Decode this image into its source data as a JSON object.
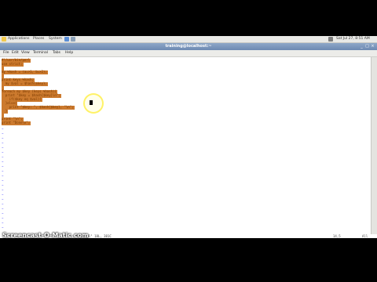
{
  "panel": {
    "items": [
      "Applications",
      "Places",
      "System"
    ],
    "clock": "Sat Jul 27, 8:51 AM"
  },
  "window": {
    "title": "training@localhost:~"
  },
  "menubar": {
    "items": [
      "File",
      "Edit",
      "View",
      "Terminal",
      "Tabs",
      "Help"
    ]
  },
  "editor": {
    "lines": [
      "#!/usr/bin/perl",
      "use strict;",
      "",
      "my %hash = (a=>1, b=>2);",
      "",
      "print keys %hash;",
      "  my $val = $hash{$key};",
      "",
      "foreach my $key (keys %hash){",
      "  print \"$key = $hash{$key}\\n\";",
      "    if($key eq $val){",
      "  }else{",
      "    print \"$key: \", $hash{$key}, \"\\n\";",
      "  }",
      "",
      "print \"\\n\";",
      "print \"Done\\n\";"
    ],
    "status_left": "\"test.pl\" 18L, 381C",
    "status_pos": "14,5",
    "status_pct": "All"
  },
  "overlay": {
    "watermark": "Screencast-O-Matic.com"
  }
}
